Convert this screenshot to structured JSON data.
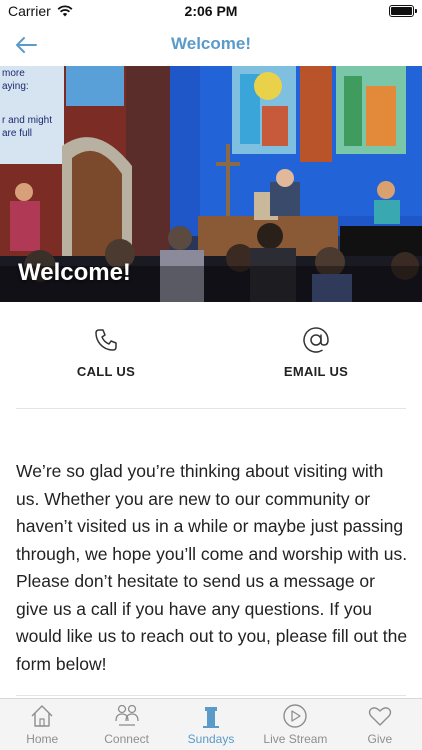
{
  "status_bar": {
    "carrier": "Carrier",
    "time": "2:06 PM"
  },
  "nav": {
    "title": "Welcome!",
    "back_icon": "arrow-left-icon"
  },
  "hero": {
    "title": "Welcome!",
    "screen_lines": [
      "more",
      "aying:",
      "",
      "r and might",
      "are full"
    ]
  },
  "actions": {
    "call": {
      "label": "CALL US",
      "icon": "phone-icon"
    },
    "email": {
      "label": "EMAIL US",
      "icon": "at-sign-icon"
    }
  },
  "body": {
    "text": "We’re so glad you’re thinking about visiting with us. Whether you are new to our community or haven’t visited us in a while or maybe just passing through, we hope you’ll come and worship with us.  Please don’t hesitate to send us a message or give us a call if you have any questions. If you would like us to reach out to you, please fill out the form below!"
  },
  "tabs": [
    {
      "label": "Home",
      "icon": "home-icon",
      "active": false
    },
    {
      "label": "Connect",
      "icon": "people-icon",
      "active": false
    },
    {
      "label": "Sundays",
      "icon": "pulpit-icon",
      "active": true
    },
    {
      "label": "Live Stream",
      "icon": "play-icon",
      "active": false
    },
    {
      "label": "Give",
      "icon": "heart-icon",
      "active": false
    }
  ],
  "colors": {
    "accent": "#5b9bc9",
    "tab_inactive": "#8e8e8e",
    "text": "#222222"
  }
}
